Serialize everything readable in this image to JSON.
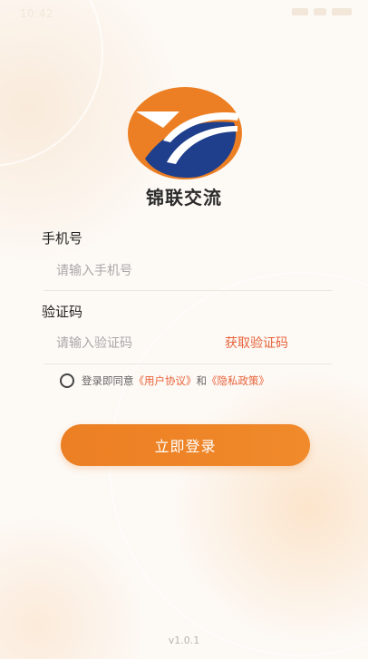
{
  "status_bar": {
    "time": "10:42"
  },
  "brand": {
    "name": "锦联交流",
    "colors": {
      "orange": "#ec7f23",
      "navy": "#1f3f8c"
    }
  },
  "form": {
    "phone": {
      "label": "手机号",
      "placeholder": "请输入手机号",
      "value": ""
    },
    "code": {
      "label": "验证码",
      "placeholder": "请输入验证码",
      "value": "",
      "get_code_label": "获取验证码"
    }
  },
  "agreement": {
    "checked": false,
    "prefix": "登录即同意",
    "user_agreement": "《用户协议》",
    "and": "和",
    "privacy_policy": "《隐私政策》"
  },
  "login_button": {
    "label": "立即登录"
  },
  "version": "v1.0.1",
  "icons": [
    "logo-icon",
    "signal-icon",
    "battery-icon",
    "checkbox-icon"
  ],
  "colors": {
    "accent": "#ec7f23",
    "link": "#e8633a"
  }
}
